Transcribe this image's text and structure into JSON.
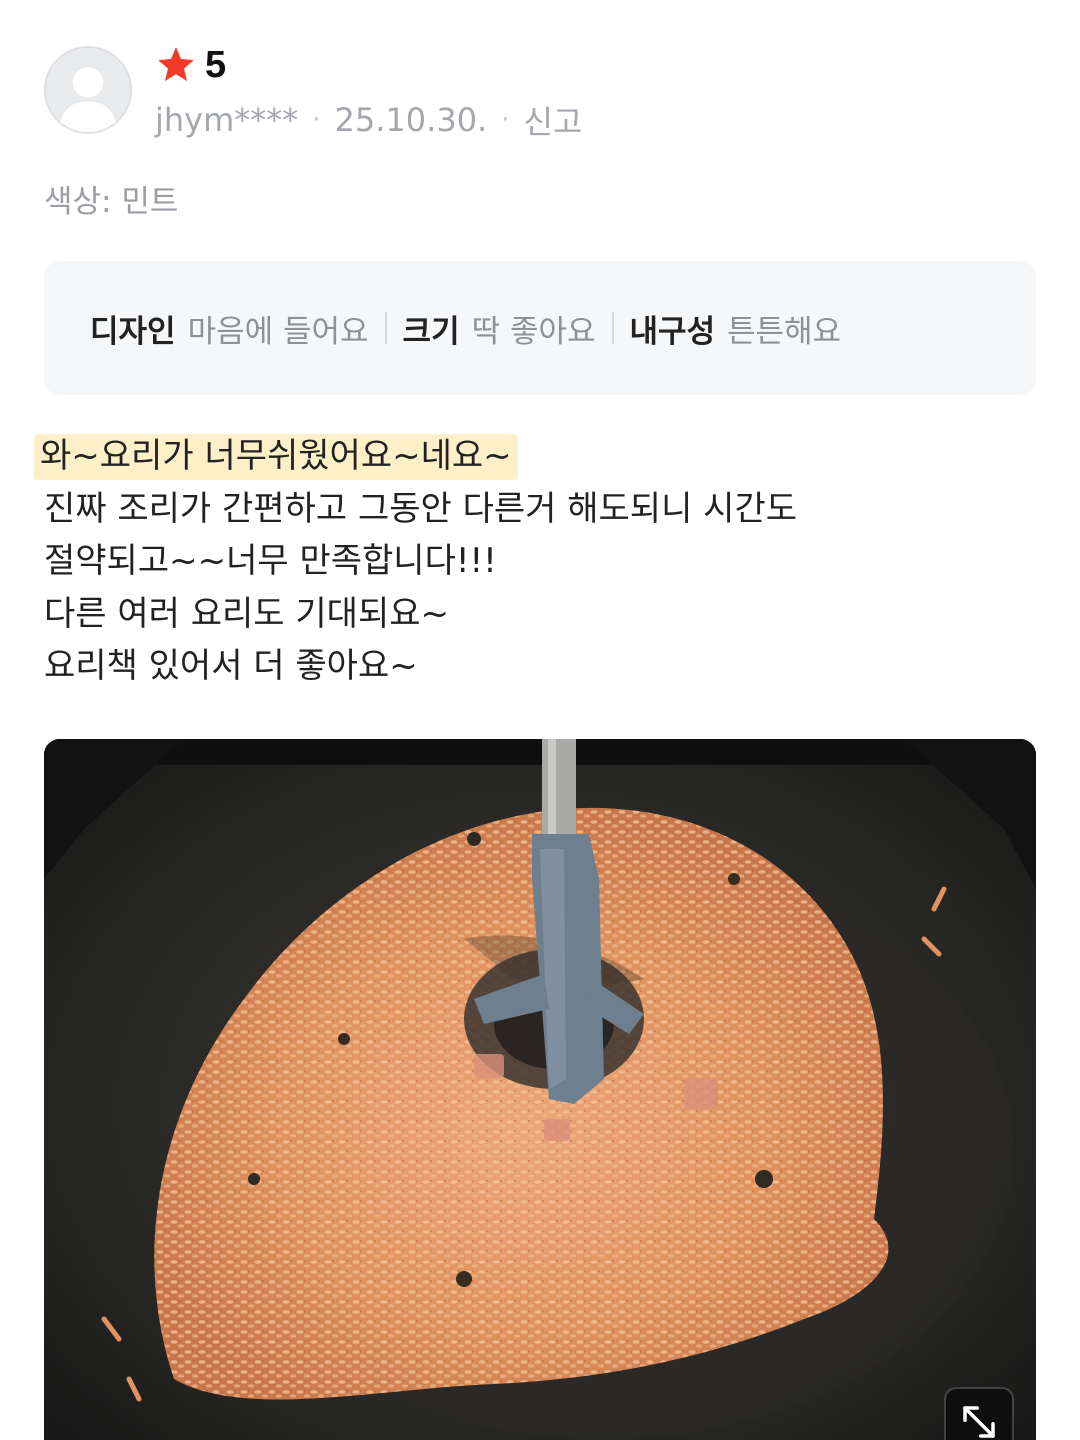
{
  "review": {
    "rating": "5",
    "username": "jhym****",
    "date": "25.10.30.",
    "report_label": "신고",
    "option": "색상: 민트",
    "tags": [
      {
        "key": "디자인",
        "value": "마음에 들어요"
      },
      {
        "key": "크기",
        "value": "딱 좋아요"
      },
      {
        "key": "내구성",
        "value": "튼튼해요"
      }
    ],
    "lines": [
      "와~요리가 너무쉬웠어요~네요~",
      "진짜 조리가 간편하고 그동안 다른거 해도되니 시간도",
      "절약되고~~너무 만족합니다!!!",
      "다른 여러 요리도 기대되요~",
      "요리책 있어서 더 좋아요~"
    ]
  },
  "icons": {
    "rating": "star-icon",
    "avatar": "default-user-icon",
    "expand": "expand-arrows-icon"
  },
  "colors": {
    "star": "#f23b2a",
    "highlight": "#fdf0c8",
    "tag_box": "#f6f7f9",
    "meta_text": "#a4a7ad"
  }
}
